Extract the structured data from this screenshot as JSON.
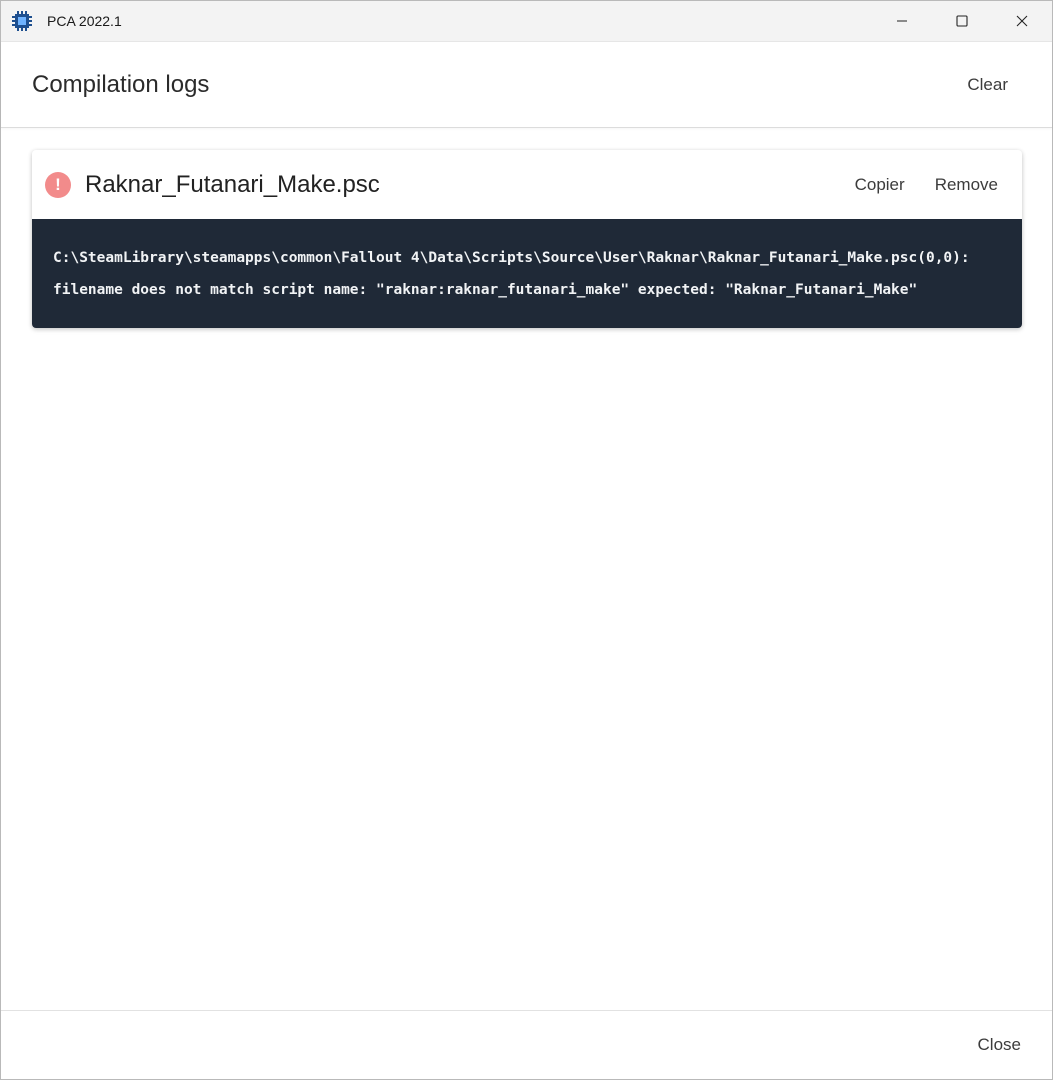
{
  "window": {
    "title": "PCA 2022.1",
    "icon": "app-chip-icon"
  },
  "header": {
    "title": "Compilation logs",
    "clear_label": "Clear"
  },
  "logs": [
    {
      "status": "error",
      "filename": "Raknar_Futanari_Make.psc",
      "copy_label": "Copier",
      "remove_label": "Remove",
      "message": "C:\\SteamLibrary\\steamapps\\common\\Fallout 4\\Data\\Scripts\\Source\\User\\Raknar\\Raknar_Futanari_Make.psc(0,0): filename does not match script name: \"raknar:raknar_futanari_make\" expected: \"Raknar_Futanari_Make\""
    }
  ],
  "footer": {
    "close_label": "Close"
  },
  "colors": {
    "error": "#f28b8b",
    "log_background": "#1f2937",
    "log_text": "#f1f3f5"
  }
}
